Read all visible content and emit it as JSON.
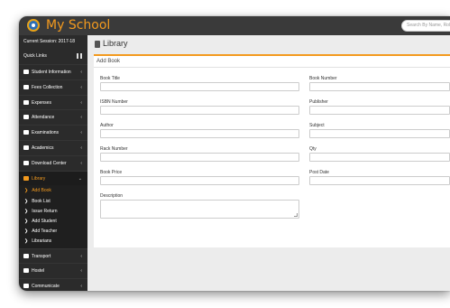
{
  "app": {
    "title": "My School"
  },
  "search": {
    "placeholder": "Search By Name, Roll"
  },
  "sidebar": {
    "session": "Current Session: 2017-18",
    "quick_links": "Quick Links",
    "items": [
      {
        "label": "Student Information",
        "icon": "user-icon"
      },
      {
        "label": "Fees Collection",
        "icon": "money-icon"
      },
      {
        "label": "Expenses",
        "icon": "credit-card-icon"
      },
      {
        "label": "Attendance",
        "icon": "calendar-icon"
      },
      {
        "label": "Examinations",
        "icon": "map-icon"
      },
      {
        "label": "Academics",
        "icon": "mortarboard-icon"
      },
      {
        "label": "Download Center",
        "icon": "download-icon"
      },
      {
        "label": "Library",
        "icon": "book-icon",
        "active": true
      },
      {
        "label": "Transport",
        "icon": "bus-icon"
      },
      {
        "label": "Hostel",
        "icon": "building-icon"
      },
      {
        "label": "Communicate",
        "icon": "bullhorn-icon"
      }
    ],
    "library_sub": [
      {
        "label": "Add Book",
        "active": true
      },
      {
        "label": "Book List"
      },
      {
        "label": "Issue Return"
      },
      {
        "label": "Add Student"
      },
      {
        "label": "Add Teacher"
      },
      {
        "label": "Librarians"
      }
    ]
  },
  "main": {
    "page_title": "Library",
    "panel_title": "Add Book",
    "fields": {
      "book_title": "Book Title",
      "book_number": "Book Number",
      "isbn_number": "ISBN Number",
      "publisher": "Publisher",
      "author": "Author",
      "subject": "Subject",
      "rack_number": "Rack Number",
      "qty": "Qty",
      "book_price": "Book Price",
      "post_date": "Post Date",
      "description": "Description"
    }
  },
  "colors": {
    "accent": "#f39a1e",
    "sidebar": "#2b2b2b",
    "topbar": "#3a3a3a"
  }
}
